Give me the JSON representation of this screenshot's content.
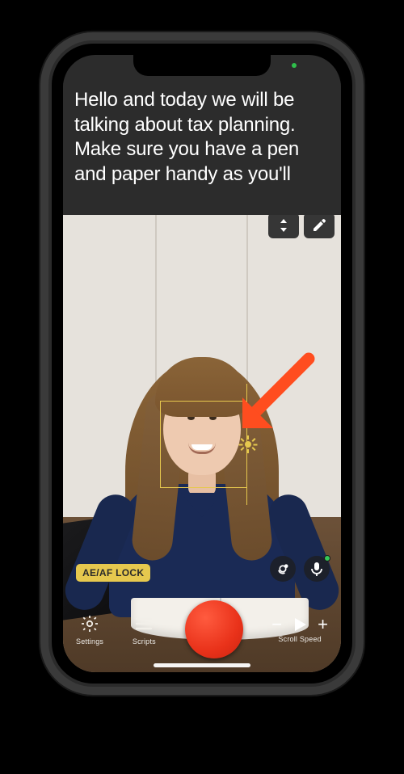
{
  "teleprompter": {
    "text": "Hello and today we will be talking about tax planning. Make sure you have a pen and paper handy as you'll"
  },
  "overlay": {
    "scroll_arrows_icon": "scroll-arrows-icon",
    "edit_icon": "pencil-icon"
  },
  "camera": {
    "aeaf_label": "AE/AF LOCK",
    "switch_camera_icon": "switch-camera-icon",
    "mic_icon": "microphone-icon",
    "mic_active": true
  },
  "bottombar": {
    "settings": {
      "label": "Settings",
      "icon": "gear-icon"
    },
    "scripts": {
      "label": "Scripts",
      "icon": "menu-icon"
    },
    "record": {
      "icon": "record-icon"
    },
    "scroll_speed": {
      "label": "Scroll Speed",
      "minus": "−",
      "plus": "+",
      "play_icon": "play-icon"
    }
  },
  "annotation": {
    "arrow_color": "#ff4d1f"
  }
}
